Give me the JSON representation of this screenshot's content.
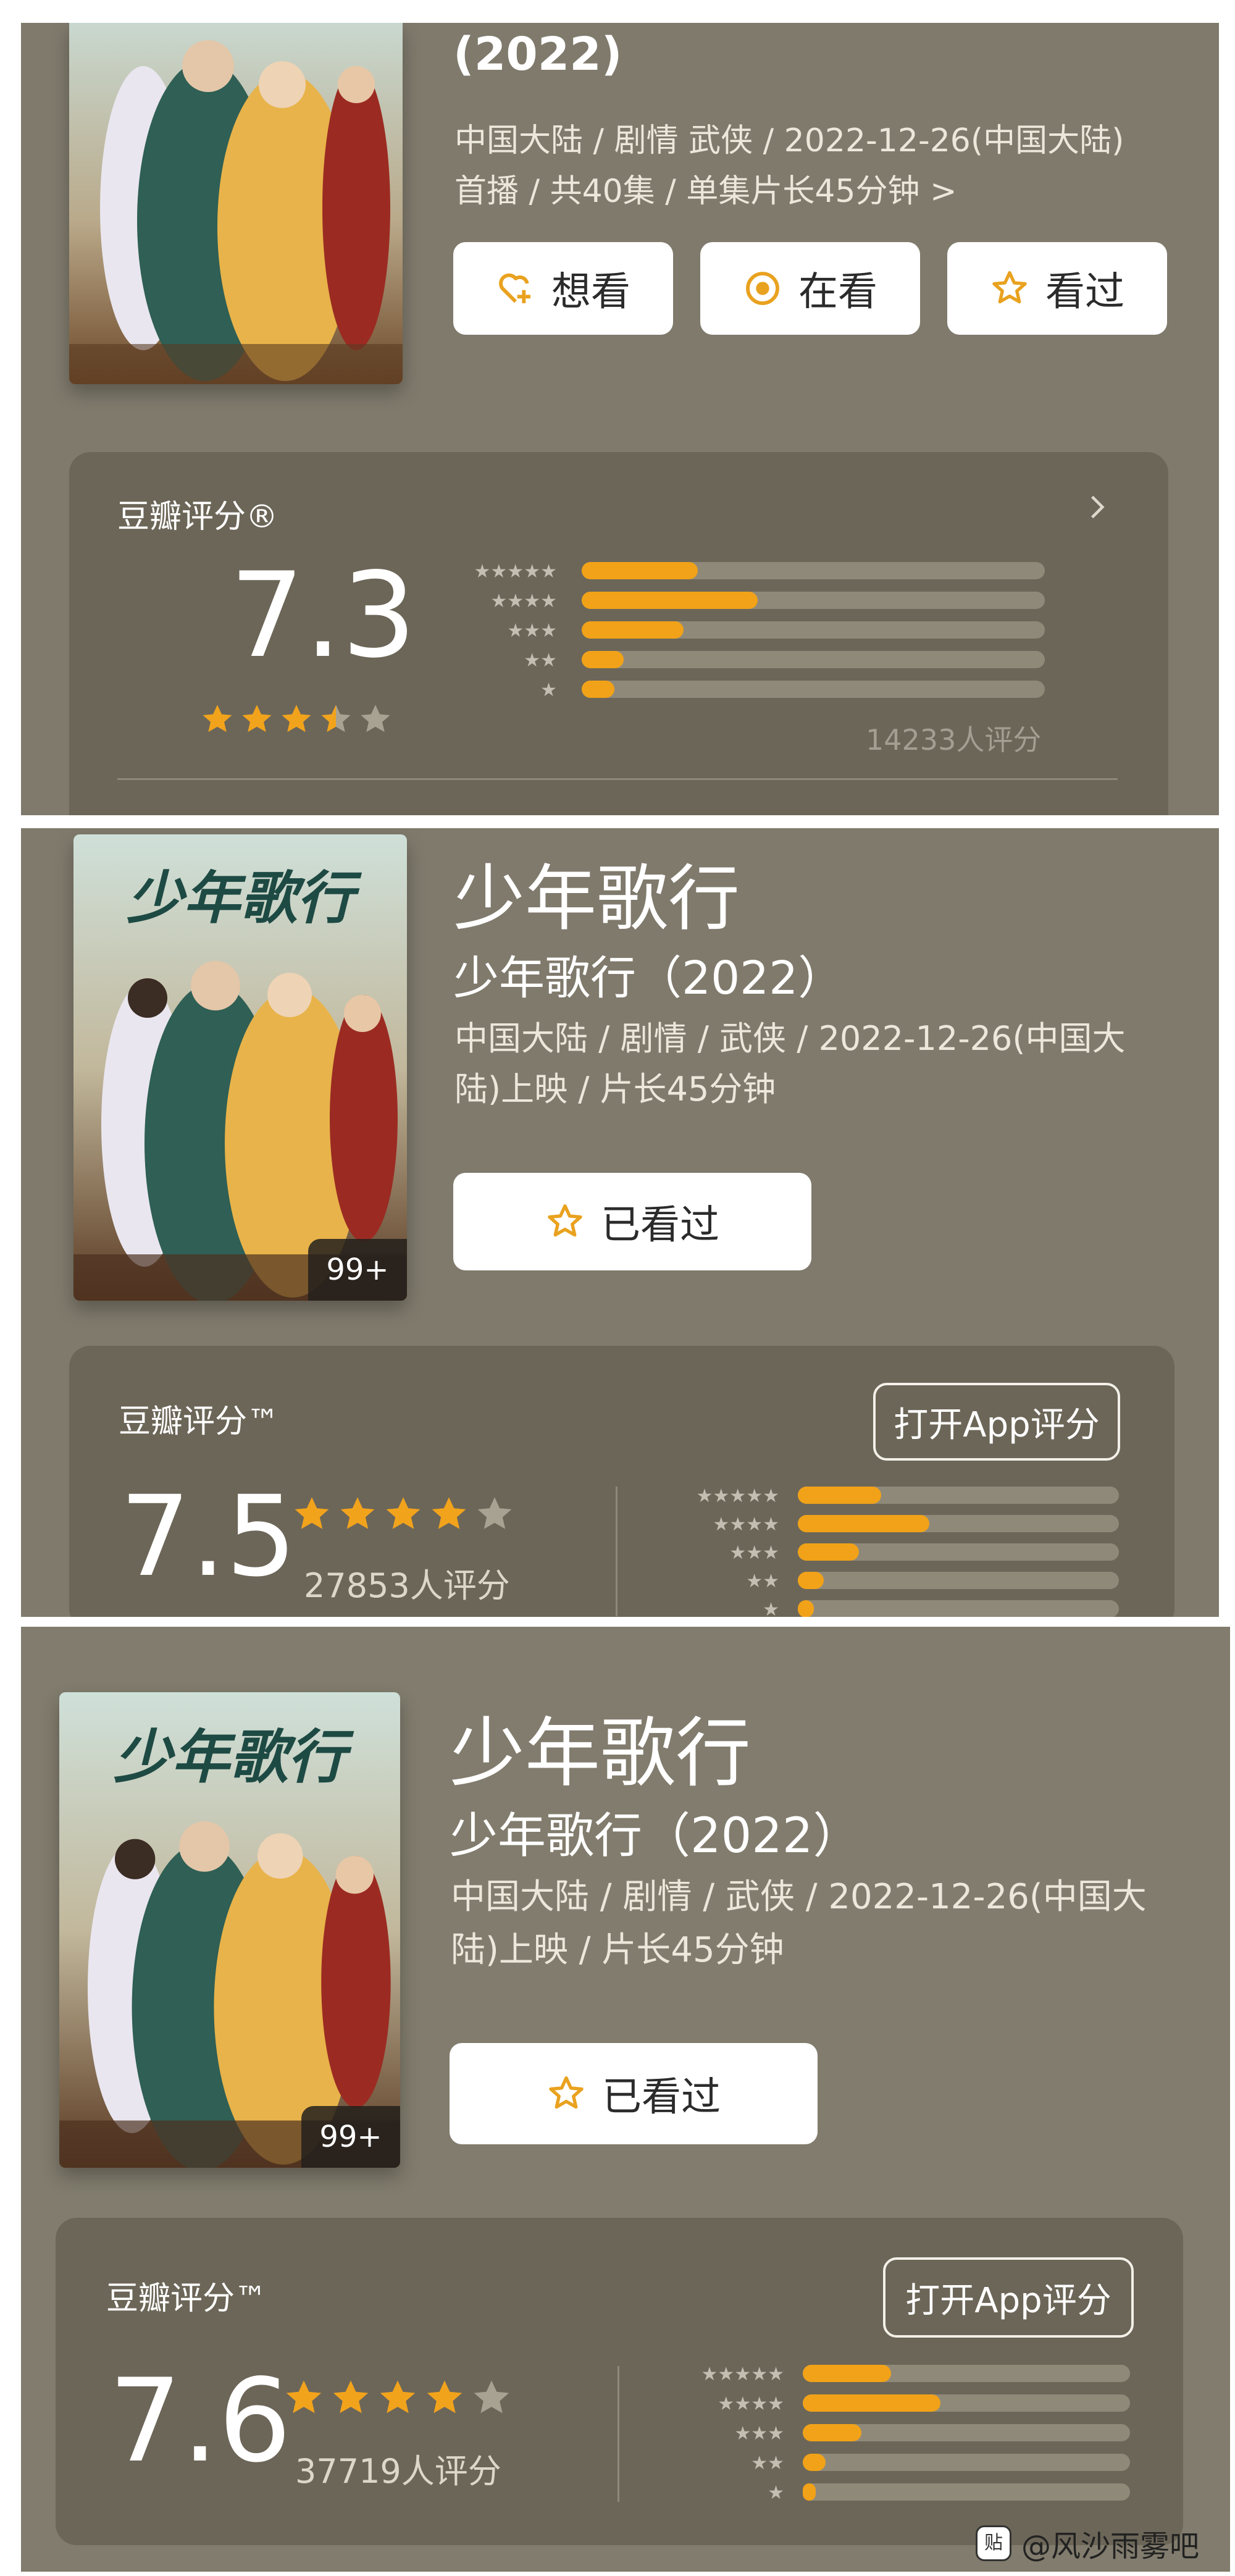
{
  "colors": {
    "panel_bg": "#7f7a6c",
    "card_bg": "#6c6658",
    "star_on": "#f2a31c",
    "star_off": "#a7a292",
    "bar_fill": "#f1a218",
    "bar_track": "#8f897a"
  },
  "panel1": {
    "title_year": "(2022)",
    "meta": "中国大陆 / 剧情 武侠 / 2022-12-26(中国大陆)首播 / 共40集 / 单集片长45分钟",
    "meta_chevron": ">",
    "buttons": [
      {
        "label": "想看",
        "icon": "heart-plus-icon"
      },
      {
        "label": "在看",
        "icon": "target-icon"
      },
      {
        "label": "看过",
        "icon": "star-outline-icon"
      }
    ],
    "rating": {
      "label": "豆瓣评分®",
      "score": "7.3",
      "stars": 3.5,
      "count_text": "14233人评分",
      "distribution": [
        0.25,
        0.38,
        0.22,
        0.09,
        0.07
      ]
    }
  },
  "panel2": {
    "title": "少年歌行",
    "subtitle": "少年歌行（2022）",
    "meta": "中国大陆 / 剧情 / 武侠 / 2022-12-26(中国大陆)上映 / 片长45分钟",
    "poster_count": "99+",
    "watched_button": "已看过",
    "rating": {
      "label": "豆瓣评分™",
      "score": "7.5",
      "stars": 4,
      "count_text": "27853人评分",
      "app_button": "打开App评分",
      "distribution": [
        0.26,
        0.41,
        0.19,
        0.08,
        0.05
      ]
    }
  },
  "panel3": {
    "title": "少年歌行",
    "subtitle": "少年歌行（2022）",
    "meta": "中国大陆 / 剧情 / 武侠 / 2022-12-26(中国大陆)上映 / 片长45分钟",
    "poster_count": "99+",
    "watched_button": "已看过",
    "rating": {
      "label": "豆瓣评分™",
      "score": "7.6",
      "stars": 4,
      "count_text": "37719人评分",
      "app_button": "打开App评分",
      "distribution": [
        0.27,
        0.42,
        0.18,
        0.07,
        0.04
      ]
    }
  },
  "watermark": {
    "logo": "贴",
    "text": "@风沙雨雾吧"
  }
}
